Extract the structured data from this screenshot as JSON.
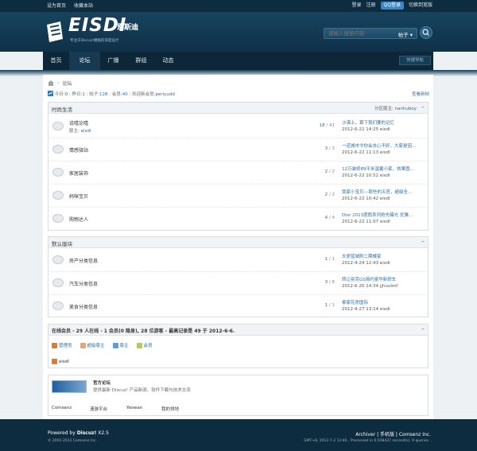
{
  "topbar": {
    "left": [
      "设为首页",
      "收藏本站"
    ],
    "login": "登录",
    "register": "注册",
    "qq_login": "QQ登录",
    "switch_to_wide": "切换到宽版"
  },
  "header": {
    "logo_text": "EISDI",
    "logo_cn": "恩斯迪",
    "logo_sub": "专注于Discuz!模板的深度设计",
    "search_placeholder": "请输入搜索内容",
    "search_type": "帖子"
  },
  "nav": {
    "items": [
      "首页",
      "论坛",
      "广播",
      "群组",
      "动态"
    ],
    "active": "论坛",
    "right_button": "快捷导航"
  },
  "breadcrumb": {
    "current": "论坛",
    "sep": "›"
  },
  "stats": {
    "today_label": "今日:",
    "today": "0",
    "yesterday_label": "昨日:",
    "yesterday": "1",
    "posts_label": "帖子:",
    "posts": "128",
    "members_label": "会员:",
    "members": "40",
    "newest_label": "欢迎新会员:",
    "newest": "periyudd",
    "new_posts": "查看新帖"
  },
  "sections": [
    {
      "title": "时尚生活",
      "moderator_label": "分区版主:",
      "moderator": "nanhuboy",
      "forums": [
        {
          "name": "说嘻论嘻",
          "mod_label": "版主:",
          "mod": "eisdl",
          "threads": "18",
          "posts": "41",
          "last_title": "沙漠上，算下我们要的记忆",
          "last_meta": "2012-6-22 14:25 eisdl"
        },
        {
          "name": "情感驿站",
          "threads": "3",
          "posts": "3",
          "last_title": "一道城市令你会去心不好，大家是因...",
          "last_meta": "2012-6-22 11:13 eisdl"
        },
        {
          "name": "家居装饰",
          "threads": "2",
          "posts": "2",
          "last_title": "12万装修89平米温馨小家，效果图...",
          "last_meta": "2012-6-22 10:52 eisdl"
        },
        {
          "name": "妈咪宝贝",
          "threads": "2",
          "posts": "2",
          "last_title": "我家小宝贝---那些的五官，超级全...",
          "last_meta": "2012-6-22 10:42 eisdl"
        },
        {
          "name": "购物达人",
          "threads": "4",
          "posts": "4",
          "last_title": "Dior 2013度假系列抢先曝光 优雅...",
          "last_meta": "2012-6-22 11:07 eisdl"
        }
      ]
    },
    {
      "title": "默认版块",
      "forums": [
        {
          "name": "房产分类信息",
          "threads": "1",
          "posts": "1",
          "last_title": "天骄蓝城附二期楼家",
          "last_meta": "2012-4-24 12:43 eisdl"
        },
        {
          "name": "汽车分类信息",
          "threads": "3",
          "posts": "8",
          "last_title": "转让别克GS简约豪华新轿车",
          "last_meta": "2012-6-20 14:34 jjhuulmf"
        },
        {
          "name": "美食分类信息",
          "threads": "1",
          "posts": "1",
          "last_title": "泰家花房国际",
          "last_meta": "2012-4-27 13:14 eisdl"
        }
      ]
    }
  ],
  "online": {
    "title": "在线会员 - 29 人在线 - 1 会员(0 隐身), 28 位游客 - 最高记录是 49 于 2012-6-6.",
    "legend": [
      {
        "label": "管理员",
        "color": "#e07b2a"
      },
      {
        "label": "超级版主",
        "color": "#e8a86a"
      },
      {
        "label": "版主",
        "color": "#5aa0d6"
      },
      {
        "label": "会员",
        "color": "#b7c95a"
      }
    ],
    "user": "eisdl"
  },
  "links": {
    "name": "官方论坛",
    "desc": "提供最新 Discuz! 产品新闻、软件下载与技术交流",
    "items": [
      "Comsenz",
      "漫游平台",
      "Yeswan",
      "我的领地"
    ]
  },
  "footer": {
    "powered_prefix": "Powered by",
    "powered": "Discuz!",
    "version": "X2.5",
    "copyright": "© 2001-2012 Comsenz Inc.",
    "links": "Archiver | 手机版 | Comsenz Inc.",
    "gmt": "GMT+8, 2012-7-2 13:46 , Processed in 0.038437 second(s), 9 queries ."
  }
}
